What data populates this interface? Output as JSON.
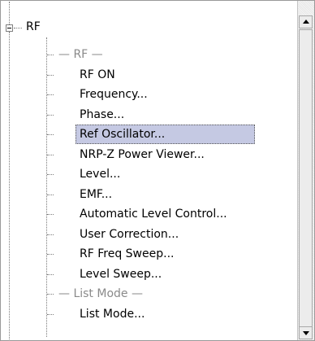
{
  "tree": {
    "root_label": "RF",
    "items": [
      {
        "label": "— RF —",
        "kind": "header"
      },
      {
        "label": "RF ON",
        "kind": "item"
      },
      {
        "label": "Frequency...",
        "kind": "item"
      },
      {
        "label": "Phase...",
        "kind": "item"
      },
      {
        "label": "Ref Oscillator...",
        "kind": "selected"
      },
      {
        "label": "NRP-Z Power Viewer...",
        "kind": "item"
      },
      {
        "label": "Level...",
        "kind": "item"
      },
      {
        "label": "EMF...",
        "kind": "item"
      },
      {
        "label": "Automatic Level Control...",
        "kind": "item"
      },
      {
        "label": "User Correction...",
        "kind": "item"
      },
      {
        "label": "RF Freq Sweep...",
        "kind": "item"
      },
      {
        "label": "Level Sweep...",
        "kind": "item"
      },
      {
        "label": "— List Mode —",
        "kind": "header"
      },
      {
        "label": "List Mode...",
        "kind": "item"
      }
    ]
  },
  "colors": {
    "selection_bg": "#c5c9e3",
    "header_text": "#8a8a8a"
  },
  "icons": {
    "expander": "minus-box-icon",
    "scroll_up": "arrow-up-icon",
    "scroll_down": "arrow-down-icon"
  }
}
